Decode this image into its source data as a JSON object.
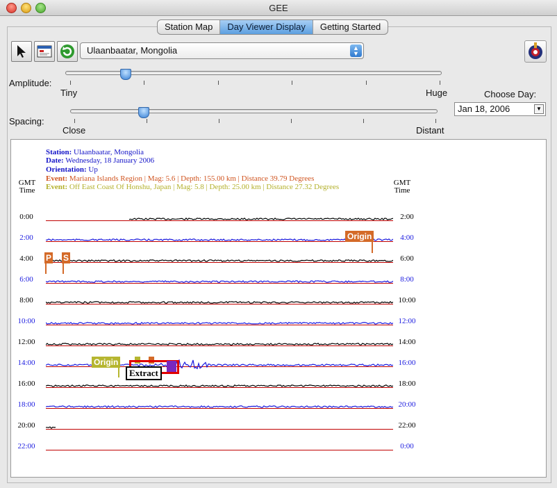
{
  "window": {
    "title": "GEE"
  },
  "tabs": [
    {
      "label": "Station Map",
      "active": false
    },
    {
      "label": "Day Viewer Display",
      "active": true
    },
    {
      "label": "Getting Started",
      "active": false
    }
  ],
  "toolbar": {
    "station_selected": "Ulaanbaatar, Mongolia",
    "tools": [
      "arrow-cursor-icon",
      "calendar-icon",
      "refresh-icon"
    ],
    "logo_icon": "gee-logo-icon"
  },
  "amplitude": {
    "label": "Amplitude:",
    "min_label": "Tiny",
    "max_label": "Huge",
    "value_fraction": 0.16
  },
  "spacing": {
    "label": "Spacing:",
    "min_label": "Close",
    "max_label": "Distant",
    "value_fraction": 0.2
  },
  "choose_day": {
    "label": "Choose Day:",
    "value": "Jan 18, 2006"
  },
  "header": {
    "station_key": "Station:",
    "station": "Ulaanbaatar, Mongolia",
    "date_key": "Date:",
    "date": "Wednesday, 18 January 2006",
    "orientation_key": "Orientation:",
    "orientation": "Up",
    "event1_key": "Event:",
    "event1": "Mariana Islands Region | Mag: 5.6 | Depth: 155.00 km | Distance 39.79 Degrees",
    "event2_key": "Event:",
    "event2": "Off East Coast Of Honshu, Japan | Mag: 5.8 | Depth: 25.00 km | Distance 27.32 Degrees",
    "gmt_left": "GMT",
    "time_left": "Time",
    "gmt_right": "GMT",
    "time_right": "Time"
  },
  "rows": [
    {
      "left": "0:00",
      "right": "2:00",
      "color": "#000000"
    },
    {
      "left": "2:00",
      "right": "4:00",
      "color": "#1a1adf"
    },
    {
      "left": "4:00",
      "right": "6:00",
      "color": "#000000"
    },
    {
      "left": "6:00",
      "right": "8:00",
      "color": "#1a1adf"
    },
    {
      "left": "8:00",
      "right": "10:00",
      "color": "#000000"
    },
    {
      "left": "10:00",
      "right": "12:00",
      "color": "#1a1adf"
    },
    {
      "left": "12:00",
      "right": "14:00",
      "color": "#000000"
    },
    {
      "left": "14:00",
      "right": "16:00",
      "color": "#1a1adf"
    },
    {
      "left": "16:00",
      "right": "18:00",
      "color": "#000000"
    },
    {
      "left": "18:00",
      "right": "20:00",
      "color": "#1a1adf"
    },
    {
      "left": "20:00",
      "right": "22:00",
      "color": "#000000"
    },
    {
      "left": "22:00",
      "right": "0:00",
      "color": "#1a1adf"
    }
  ],
  "markers": {
    "origin1": "Origin",
    "p": "P",
    "s": "S",
    "origin2": "Origin",
    "extract": "Extract"
  },
  "colors": {
    "event1": "#d0541f",
    "event2": "#b3b02a",
    "info_blue": "#1414c8",
    "marker_orange": "#d46a28",
    "marker_olive": "#b6b630",
    "extract_red": "#e00000"
  }
}
